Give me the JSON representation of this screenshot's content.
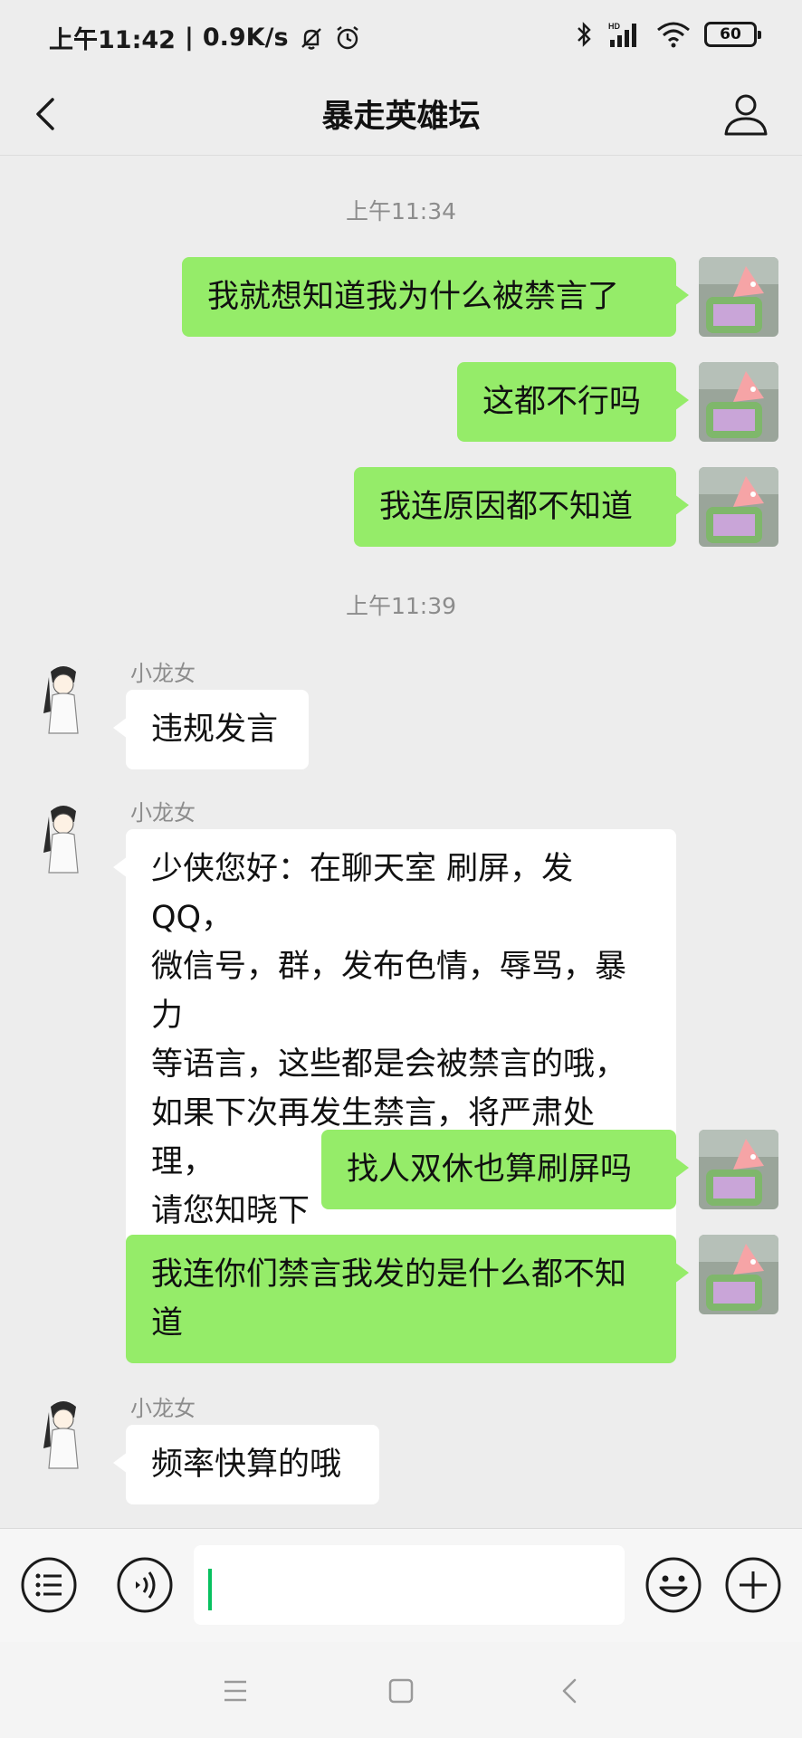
{
  "status_bar": {
    "time": "上午11:42",
    "speed": "0.9K/s",
    "network_type": "HD",
    "battery": "60"
  },
  "nav": {
    "title": "暴走英雄坛"
  },
  "chat": {
    "timestamp_1": "上午11:34",
    "timestamp_2": "上午11:39",
    "messages": [
      {
        "sender": "me",
        "text": "我就想知道我为什么被禁言了"
      },
      {
        "sender": "me",
        "text": "这都不行吗"
      },
      {
        "sender": "me",
        "text": "我连原因都不知道"
      },
      {
        "sender": "小龙女",
        "name": "小龙女",
        "text": "违规发言"
      },
      {
        "sender": "小龙女",
        "name": "小龙女",
        "lines": [
          "少侠您好：在聊天室 刷屏，发QQ，",
          "微信号，群，发布色情，辱骂，暴力",
          "等语言，这些都是会被禁言的哦，",
          "如果下次再发生禁言，将严肃处理，",
          "请您知晓下"
        ]
      },
      {
        "sender": "me",
        "text": "找人双休也算刷屏吗"
      },
      {
        "sender": "me",
        "lines": [
          "我连你们禁言我发的是什么都不知",
          "道"
        ]
      },
      {
        "sender": "小龙女",
        "name": "小龙女",
        "text": "频率快算的哦"
      }
    ]
  },
  "input": {
    "value": ""
  },
  "colors": {
    "self_bubble": "#95ec69",
    "other_bubble": "#ffffff",
    "background": "#ededed",
    "cursor": "#07c160"
  },
  "icons": {
    "back": "chevron-left-icon",
    "profile": "person-icon",
    "menu": "list-icon",
    "voice": "voice-icon",
    "emoji": "smile-icon",
    "add": "plus-icon"
  }
}
